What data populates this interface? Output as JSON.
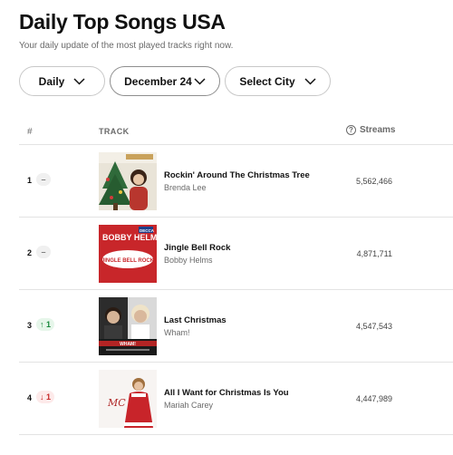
{
  "header": {
    "title": "Daily Top Songs USA",
    "subtitle": "Your daily update of the most played tracks right now."
  },
  "filters": {
    "frequency": "Daily",
    "date": "December 24",
    "city": "Select City"
  },
  "table": {
    "col_rank": "#",
    "col_track": "TRACK",
    "col_streams": "Streams",
    "info_glyph": "?",
    "rows": [
      {
        "rank": "1",
        "change": "–",
        "change_type": "same",
        "title": "Rockin' Around The Christmas Tree",
        "artist": "Brenda Lee",
        "streams": "5,562,466"
      },
      {
        "rank": "2",
        "change": "–",
        "change_type": "same",
        "title": "Jingle Bell Rock",
        "artist": "Bobby Helms",
        "streams": "4,871,711"
      },
      {
        "rank": "3",
        "change": "↑ 1",
        "change_type": "up",
        "title": "Last Christmas",
        "artist": "Wham!",
        "streams": "4,547,543"
      },
      {
        "rank": "4",
        "change": "↓ 1",
        "change_type": "down",
        "title": "All I Want for Christmas Is You",
        "artist": "Mariah Carey",
        "streams": "4,447,989"
      }
    ]
  },
  "artwork": {
    "row2_band": "BOBBY HELMS",
    "row2_label": "JINGLE BELL ROCK",
    "row2_logo": "DECCA",
    "row3_band": "WHAM!",
    "row4_logo": "MC"
  },
  "colors": {
    "up": "#1b8a3e",
    "down": "#c72a2a",
    "neutral": "#777777"
  }
}
